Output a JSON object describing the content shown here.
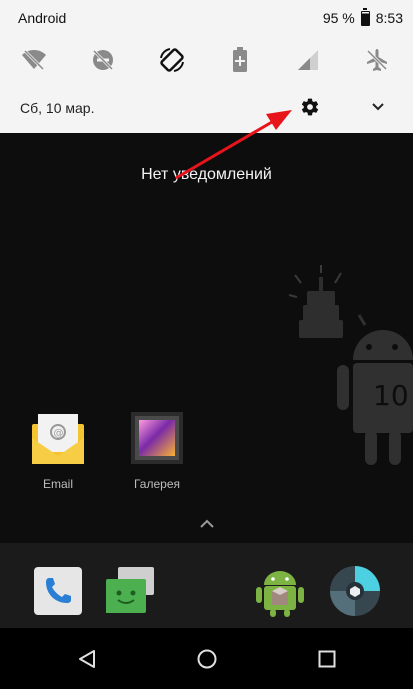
{
  "status_bar": {
    "carrier": "Android",
    "battery_percent": "95 %",
    "time": "8:53"
  },
  "quick_settings": {
    "tiles": [
      {
        "icon": "wifi-off-icon"
      },
      {
        "icon": "dnd-off-icon"
      },
      {
        "icon": "auto-rotate-icon"
      },
      {
        "icon": "battery-saver-icon"
      },
      {
        "icon": "cellular-signal-icon"
      },
      {
        "icon": "airplane-mode-icon"
      }
    ]
  },
  "header": {
    "date": "Сб, 10 мар."
  },
  "notifications": {
    "empty_text": "Нет уведомлений"
  },
  "home": {
    "apps": [
      {
        "label": "Email",
        "icon": "email-icon"
      },
      {
        "label": "Галерея",
        "icon": "gallery-icon"
      }
    ]
  },
  "dock": {
    "apps": [
      {
        "icon": "phone-icon"
      },
      {
        "icon": "messages-icon"
      },
      {
        "icon": "play-store-icon"
      },
      {
        "icon": "camera-icon"
      }
    ]
  },
  "colors": {
    "shade_bg": "#f4f4f4",
    "home_bg": "#0d0d0d",
    "annotation_arrow": "#e8141c"
  }
}
